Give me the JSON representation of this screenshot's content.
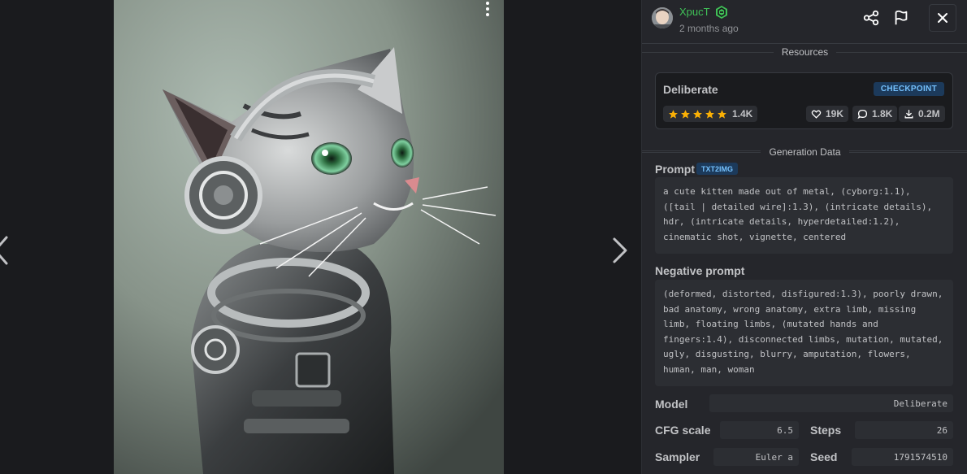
{
  "viewer": {
    "image_alt": "a cute kitten made out of metal"
  },
  "header": {
    "username": "XpucT",
    "time_ago": "2 months ago"
  },
  "resources": {
    "heading": "Resources",
    "items": [
      {
        "name": "Deliberate",
        "type": "CHECKPOINT",
        "rating_count": "1.4K",
        "stars": 5,
        "likes": "19K",
        "comments": "1.8K",
        "downloads": "0.2M"
      }
    ]
  },
  "generation": {
    "heading": "Generation Data",
    "prompt_label": "Prompt",
    "prompt_tag": "TXT2IMG",
    "prompt": "a cute kitten made out of metal, (cyborg:1.1),\n([tail | detailed wire]:1.3), (intricate details),\nhdr, (intricate details, hyperdetailed:1.2),\ncinematic shot, vignette, centered",
    "negative_label": "Negative prompt",
    "negative_prompt": "(deformed, distorted, disfigured:1.3), poorly drawn,\nbad anatomy, wrong anatomy, extra limb, missing\nlimb, floating limbs, (mutated hands and\nfingers:1.4), disconnected limbs, mutation, mutated,\nugly, disgusting, blurry, amputation, flowers,\nhuman, man, woman",
    "params": {
      "model_label": "Model",
      "model": "Deliberate",
      "cfg_label": "CFG scale",
      "cfg": "6.5",
      "steps_label": "Steps",
      "steps": "26",
      "sampler_label": "Sampler",
      "sampler": "Euler a",
      "seed_label": "Seed",
      "seed": "1791574510"
    }
  },
  "colors": {
    "username": "#40c057",
    "star": "#fab005",
    "tag_bg": "#1c3a5b",
    "tag_text": "#74c0fc",
    "panel_bg": "#25262b",
    "page_bg": "#1a1b1e"
  }
}
